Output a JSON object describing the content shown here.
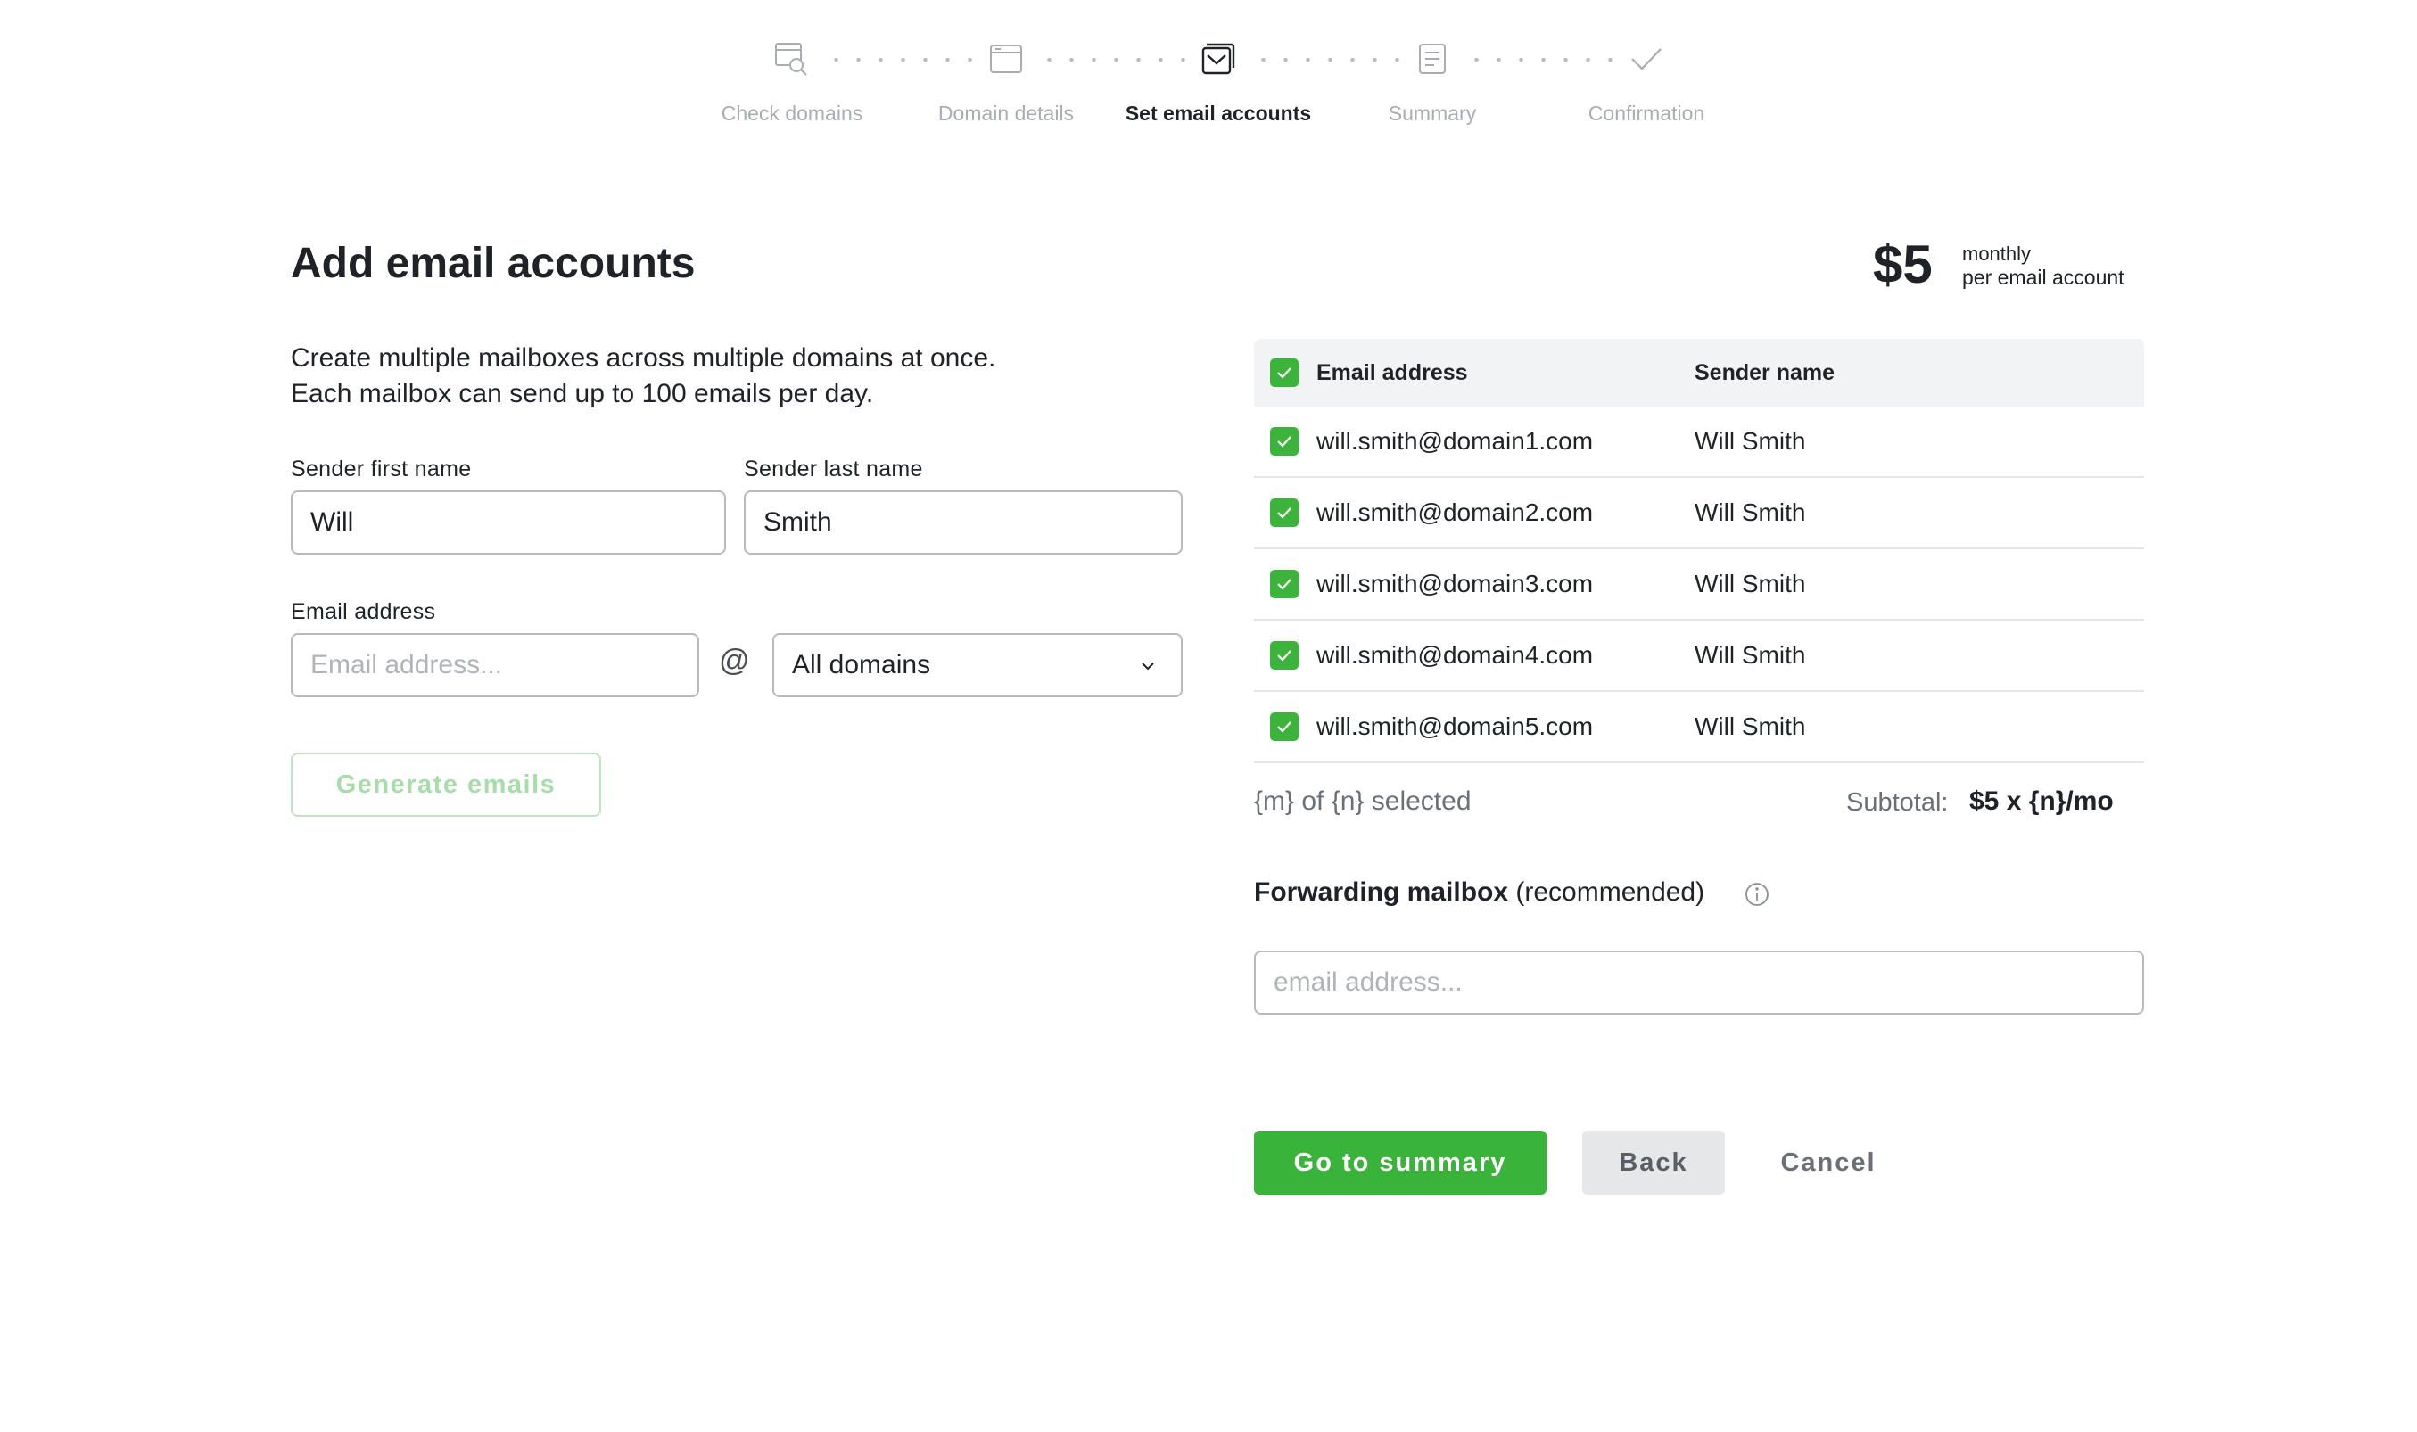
{
  "stepper": {
    "steps": [
      {
        "label": "Check domains",
        "icon": "domain-search-icon",
        "state": "done"
      },
      {
        "label": "Domain details",
        "icon": "browser-window-icon",
        "state": "done"
      },
      {
        "label": "Set email accounts",
        "icon": "email-accounts-icon",
        "state": "active"
      },
      {
        "label": "Summary",
        "icon": "document-icon",
        "state": "pending"
      },
      {
        "label": "Confirmation",
        "icon": "checkmark-icon",
        "state": "pending"
      }
    ]
  },
  "form": {
    "title": "Add email accounts",
    "intro_line1": "Create multiple mailboxes across multiple domains at once.",
    "intro_line2": "Each mailbox can send up to 100 emails per day.",
    "first_name_label": "Sender first name",
    "first_name_value": "Will",
    "last_name_label": "Sender last name",
    "last_name_value": "Smith",
    "email_label": "Email address",
    "email_placeholder": "Email address...",
    "at_sign": "@",
    "domain_select_value": "All domains",
    "generate_label": "Generate emails"
  },
  "pricing": {
    "amount": "$5",
    "period": "monthly",
    "unit": "per email account"
  },
  "table": {
    "header_email": "Email address",
    "header_name": "Sender name",
    "rows": [
      {
        "email": "will.smith@domain1.com",
        "name": "Will Smith",
        "checked": true
      },
      {
        "email": "will.smith@domain2.com",
        "name": "Will Smith",
        "checked": true
      },
      {
        "email": "will.smith@domain3.com",
        "name": "Will Smith",
        "checked": true
      },
      {
        "email": "will.smith@domain4.com",
        "name": "Will Smith",
        "checked": true
      },
      {
        "email": "will.smith@domain5.com",
        "name": "Will Smith",
        "checked": true
      }
    ],
    "selected_text": "{m} of {n} selected",
    "subtotal_label": "Subtotal:",
    "subtotal_value": "$5 x {n}/mo"
  },
  "forwarding": {
    "title_bold": "Forwarding mailbox",
    "title_rest": " (recommended)",
    "placeholder": "email address..."
  },
  "actions": {
    "primary": "Go to summary",
    "back": "Back",
    "cancel": "Cancel"
  },
  "colors": {
    "accent_green": "#39b33a",
    "checkbox_green": "#3cb43c",
    "text_dark": "#1f2328",
    "muted": "#a9adb3"
  }
}
